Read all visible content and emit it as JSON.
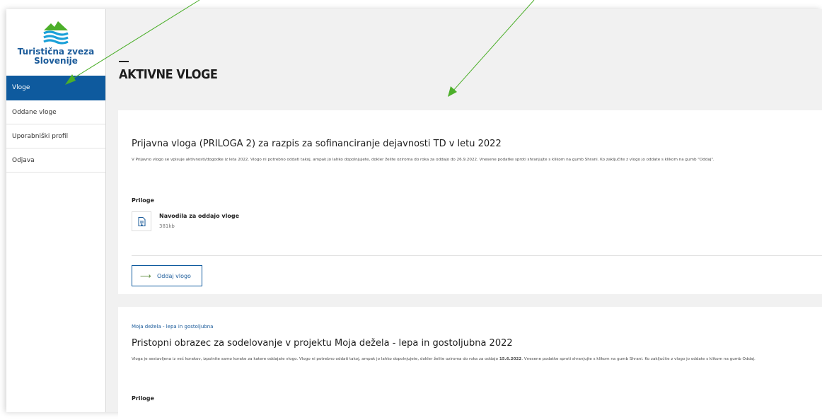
{
  "brand": {
    "name_line1": "Turistična zveza",
    "name_line2": "Slovenije"
  },
  "sidebar": {
    "items": [
      {
        "label": "Vloge",
        "active": true
      },
      {
        "label": "Oddane vloge",
        "active": false
      },
      {
        "label": "Uporabniški profil",
        "active": false
      },
      {
        "label": "Odjava",
        "active": false
      }
    ]
  },
  "page": {
    "title": "AKTIVNE VLOGE"
  },
  "cards": [
    {
      "title": "Prijavna vloga (PRILOGA 2) za razpis za sofinanciranje dejavnosti TD v letu 2022",
      "description": "V Prijavno vlogo se vpisuje aktivnosti/dogodke iz leta 2022. Vlogo ni potrebno oddati takoj, ampak jo lahko dopolnjujete, dokler želite oziroma do roka za oddajo do 26.9.2022. Vnesene podatke sproti shranjujte s klikom na gumb Shrani. Ko zaključite z vlogo jo oddate s klikom na gumb \"Oddaj\".",
      "attachments_label": "Priloge",
      "attachment": {
        "name": "Navodila za oddajo vloge",
        "size": "381kb"
      },
      "button_label": "Oddaj vlogo"
    },
    {
      "tag": "Moja dežela - lepa in gostoljubna",
      "title": "Pristopni obrazec za sodelovanje v projektu Moja dežela - lepa in gostoljubna 2022",
      "description_before": "Vloga je sestavljena iz več korakov, izpolnite samo korake za katere oddajate vlogo. Vlogo ni potrebno oddati takoj, ampak jo lahko dopolnjujete, dokler želite oziroma do roka za oddajo ",
      "description_date": "15.6.2022",
      "description_after": ". Vnesene podatke sproti shranjujte s klikom na gumb Shrani. Ko zaključite z vlogo jo oddate s klikom na gumb Oddaj.",
      "attachments_label": "Priloge"
    }
  ],
  "colors": {
    "brand_blue": "#0e5a9e",
    "annotation_green": "#4caf2a",
    "page_bg": "#f1f1f1"
  },
  "icons": {
    "logo": "mountain-waves-logo",
    "attachment": "document-download-icon",
    "button": "arrow-right-icon"
  }
}
